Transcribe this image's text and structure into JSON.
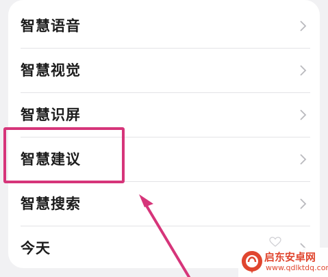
{
  "menu": {
    "items": [
      {
        "label": "智慧语音"
      },
      {
        "label": "智慧视觉"
      },
      {
        "label": "智慧识屏"
      },
      {
        "label": "智慧建议"
      },
      {
        "label": "智慧搜索"
      },
      {
        "label": "今天"
      }
    ]
  },
  "annotation": {
    "highlight_color": "#d6357a",
    "arrow_color": "#d6357a"
  },
  "watermark": {
    "title": "启东安卓网",
    "url": "www.qdlktdq.com",
    "brand_color": "#e0462f"
  }
}
